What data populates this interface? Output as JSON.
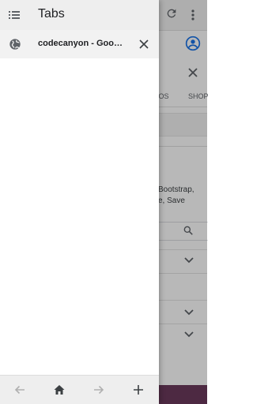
{
  "drawer": {
    "title": "Tabs",
    "tabs": [
      {
        "title": "codecanyon - Googl..."
      }
    ]
  },
  "background_page": {
    "tab_strip_items": [
      "DEOS",
      "SHOP"
    ],
    "snippet_line_1": "Bootstrap,",
    "snippet_line_2": "e, Save"
  },
  "icons": {
    "menu": "list-icon",
    "tab_favicon": "globe-icon",
    "tab_close": "close-icon",
    "back": "arrow-left-icon",
    "home": "home-icon",
    "forward": "arrow-right-icon",
    "new_tab": "plus-icon"
  },
  "colors": {
    "header_bg": "#eeeeee",
    "selected_row_bg": "#f2f2f2",
    "icon_dark": "#5f6368",
    "icon_disabled": "#b0b0b0",
    "accent": "#1a73e8"
  }
}
